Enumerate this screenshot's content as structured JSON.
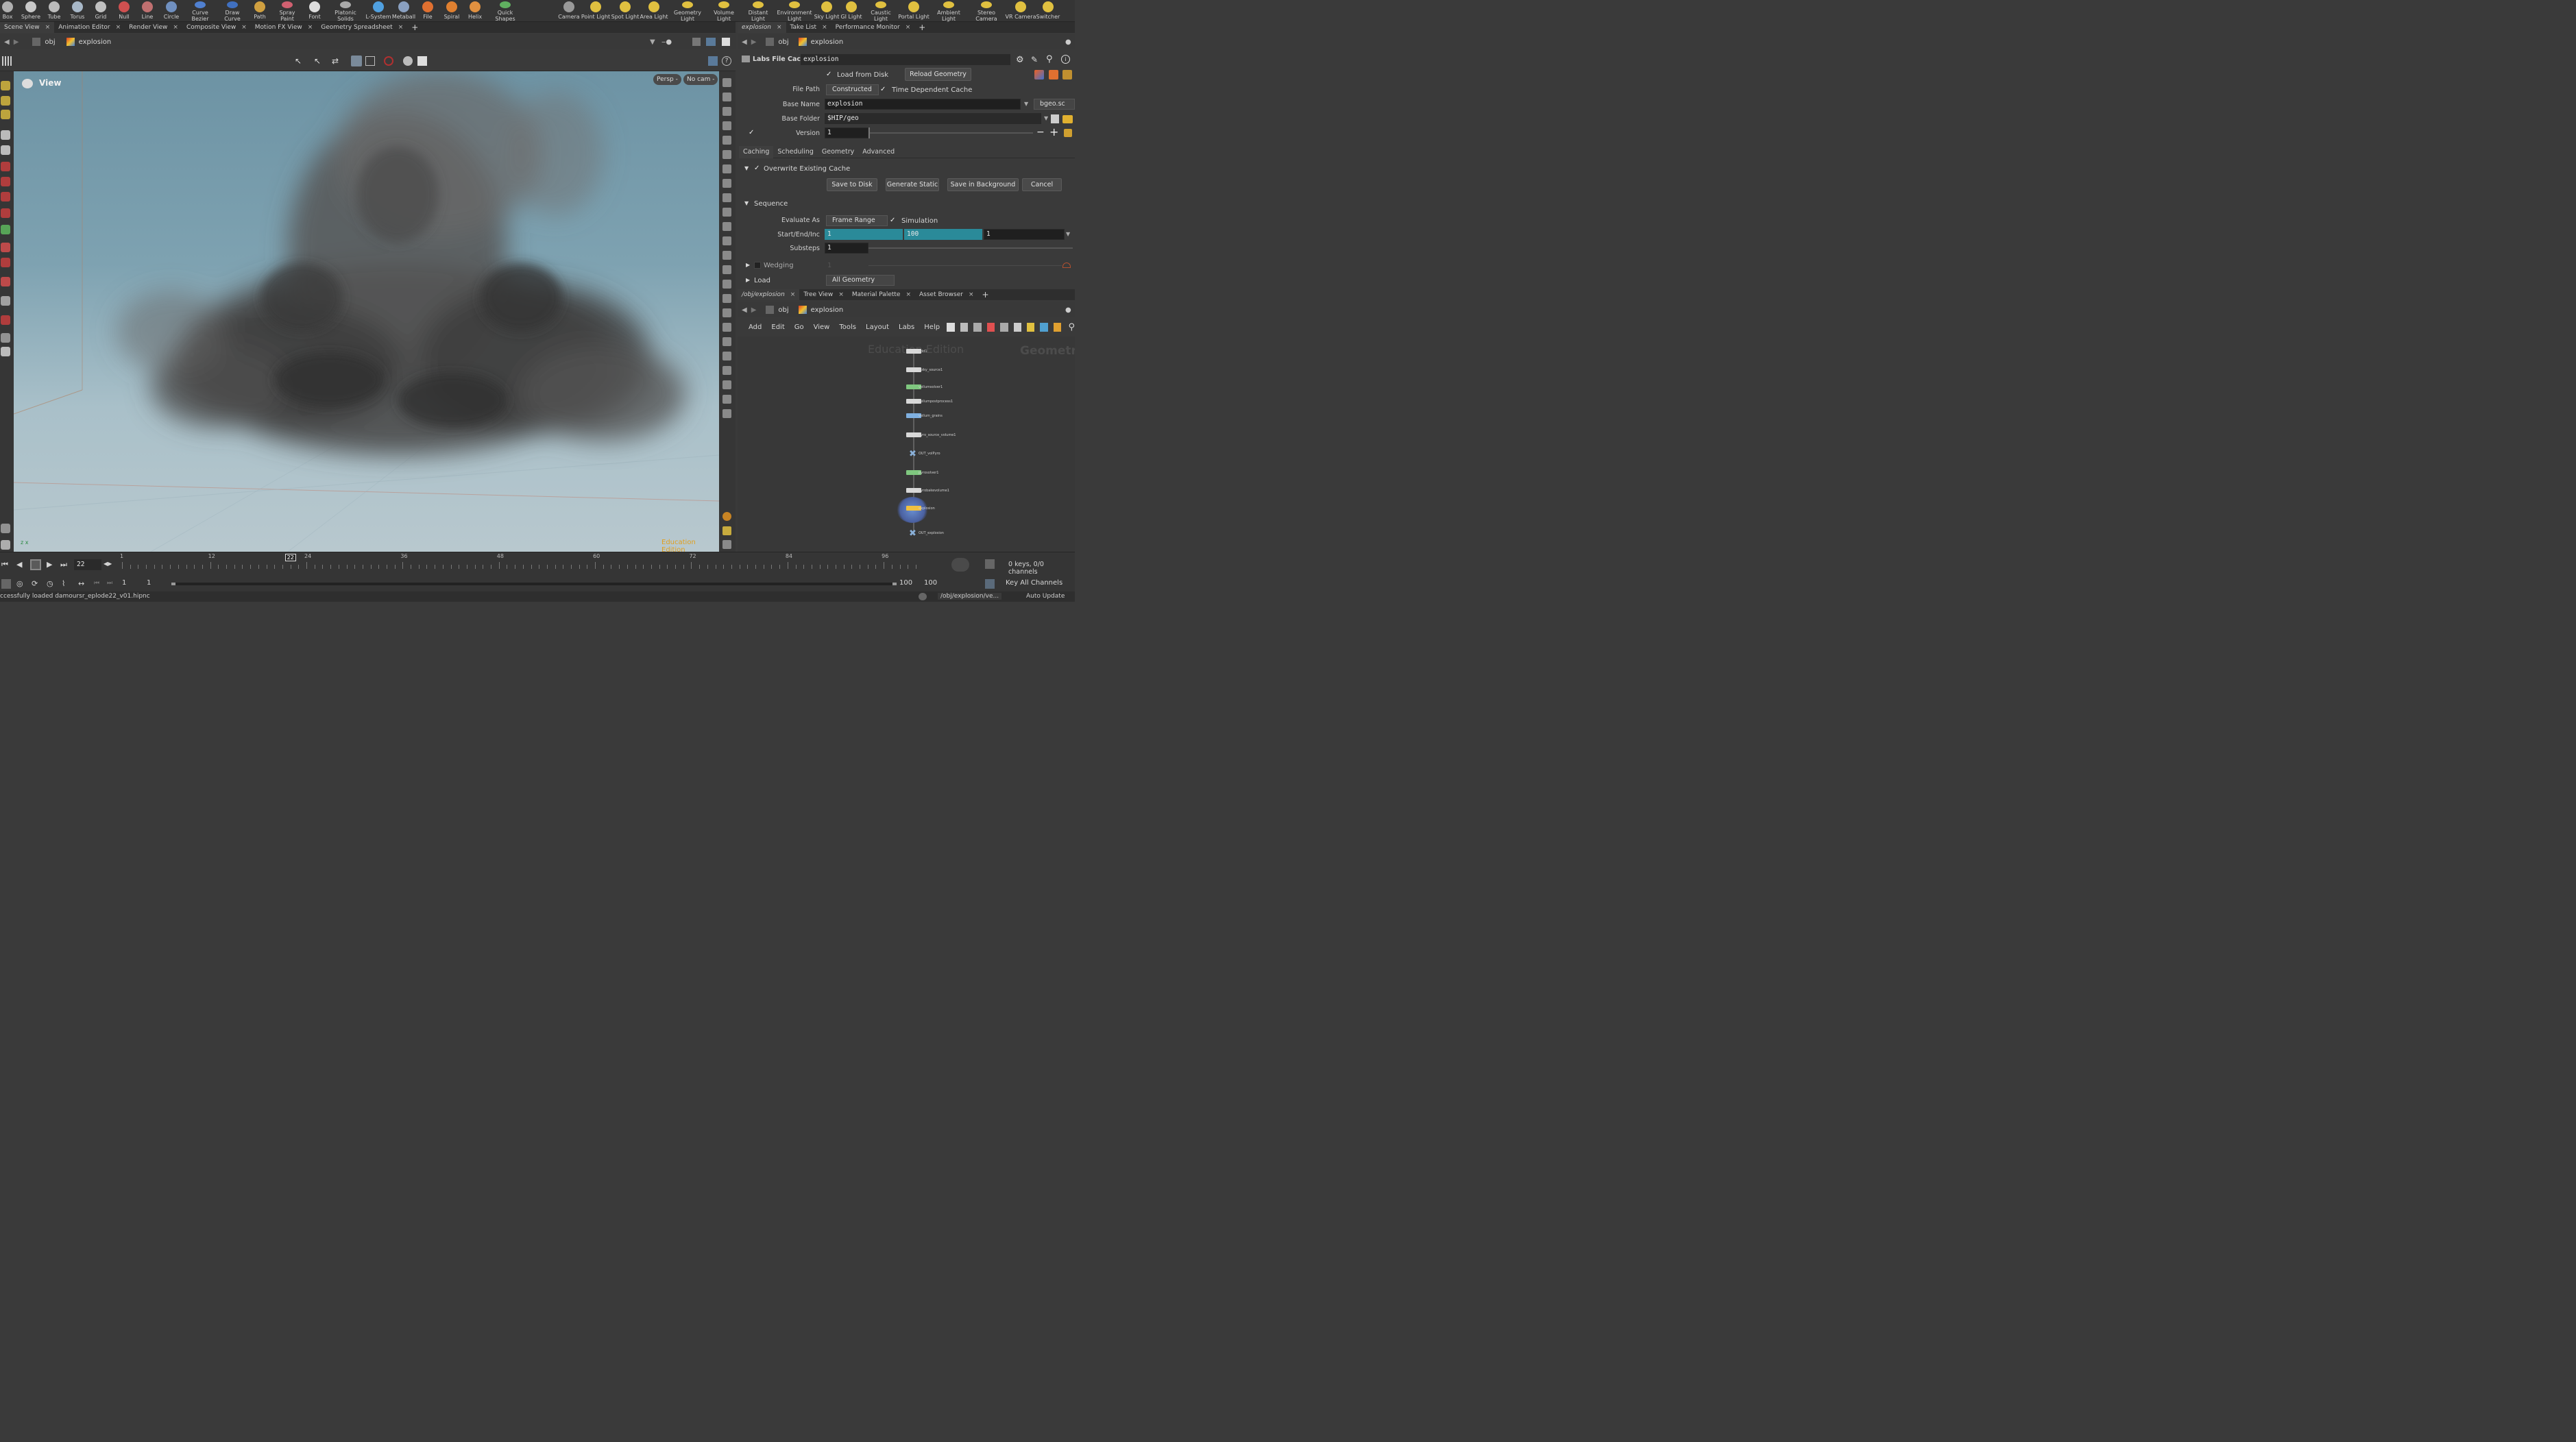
{
  "shelf": {
    "left_tools": [
      {
        "label": "Box",
        "icon": "box-icon"
      },
      {
        "label": "Sphere",
        "icon": "sphere-icon"
      },
      {
        "label": "Tube",
        "icon": "tube-icon"
      },
      {
        "label": "Torus",
        "icon": "torus-icon"
      },
      {
        "label": "Grid",
        "icon": "grid-icon"
      },
      {
        "label": "Null",
        "icon": "null-icon"
      },
      {
        "label": "Line",
        "icon": "line-icon"
      },
      {
        "label": "Circle",
        "icon": "circle-icon"
      },
      {
        "label": "Curve Bezier",
        "icon": "curve-bezier-icon"
      },
      {
        "label": "Draw Curve",
        "icon": "draw-curve-icon"
      },
      {
        "label": "Path",
        "icon": "path-icon"
      },
      {
        "label": "Spray Paint",
        "icon": "spray-paint-icon"
      },
      {
        "label": "Font",
        "icon": "font-icon"
      },
      {
        "label": "Platonic Solids",
        "icon": "platonic-solids-icon"
      },
      {
        "label": "L-System",
        "icon": "l-system-icon"
      },
      {
        "label": "Metaball",
        "icon": "metaball-icon"
      },
      {
        "label": "File",
        "icon": "file-icon"
      },
      {
        "label": "Spiral",
        "icon": "spiral-icon"
      },
      {
        "label": "Helix",
        "icon": "helix-icon"
      },
      {
        "label": "Quick Shapes",
        "icon": "quick-shapes-icon"
      }
    ],
    "right_tools": [
      {
        "label": "Camera",
        "icon": "camera-icon"
      },
      {
        "label": "Point Light",
        "icon": "point-light-icon"
      },
      {
        "label": "Spot Light",
        "icon": "spot-light-icon"
      },
      {
        "label": "Area Light",
        "icon": "area-light-icon"
      },
      {
        "label": "Geometry Light",
        "icon": "geometry-light-icon"
      },
      {
        "label": "Volume Light",
        "icon": "volume-light-icon"
      },
      {
        "label": "Distant Light",
        "icon": "distant-light-icon"
      },
      {
        "label": "Environment Light",
        "icon": "environment-light-icon"
      },
      {
        "label": "Sky Light",
        "icon": "sky-light-icon"
      },
      {
        "label": "GI Light",
        "icon": "gi-light-icon"
      },
      {
        "label": "Caustic Light",
        "icon": "caustic-light-icon"
      },
      {
        "label": "Portal Light",
        "icon": "portal-light-icon"
      },
      {
        "label": "Ambient Light",
        "icon": "ambient-light-icon"
      },
      {
        "label": "Stereo Camera",
        "icon": "stereo-camera-icon"
      },
      {
        "label": "VR Camera",
        "icon": "vr-camera-icon"
      },
      {
        "label": "Switcher",
        "icon": "switcher-icon"
      }
    ]
  },
  "left_tabs": [
    "Scene View",
    "Animation Editor",
    "Render View",
    "Composite View",
    "Motion FX View",
    "Geometry Spreadsheet"
  ],
  "left_path": {
    "root": "obj",
    "node": "explosion"
  },
  "viewport": {
    "title": "View",
    "persp": "Persp -",
    "cam": "No cam -",
    "watermark": "Education Edition",
    "axes_label": "z x"
  },
  "right_tabs": [
    "explosion",
    "Take List",
    "Performance Monitor"
  ],
  "right_path": {
    "root": "obj",
    "node": "explosion"
  },
  "params": {
    "node_type": "Labs File Cache",
    "node_name": "explosion",
    "load_from_disk": "Load from Disk",
    "reload_geometry": "Reload Geometry",
    "file_path_label": "File Path",
    "file_path_value": "Constructed",
    "time_dependent": "Time Dependent Cache",
    "base_name_label": "Base Name",
    "base_name_value": "explosion",
    "ext_value": "bgeo.sc",
    "base_folder_label": "Base Folder",
    "base_folder_value": "$HIP/geo",
    "version_label": "Version",
    "version_value": "1",
    "tabs": [
      "Caching",
      "Scheduling",
      "Geometry",
      "Advanced"
    ],
    "overwrite": "Overwrite Existing Cache",
    "save_to_disk": "Save to Disk",
    "generate_static": "Generate Static",
    "save_background": "Save in Background",
    "cancel": "Cancel",
    "sequence": "Sequence",
    "evaluate_label": "Evaluate As",
    "evaluate_value": "Frame Range",
    "simulation": "Simulation",
    "start_end_label": "Start/End/Inc",
    "start": "1",
    "end": "100",
    "inc": "1",
    "substeps_label": "Substeps",
    "substeps_value": "1",
    "wedging": "Wedging",
    "wedging_value": "1",
    "load_label": "Load",
    "load_value": "All Geometry"
  },
  "network_tabs": [
    "/obj/explosion",
    "Tree View",
    "Material Palette",
    "Asset Browser"
  ],
  "network_path": {
    "root": "obj",
    "node": "explosion"
  },
  "network_menu": [
    "Add",
    "Edit",
    "Go",
    "View",
    "Tools",
    "Layout",
    "Labs",
    "Help"
  ],
  "network_watermarks": {
    "edu": "Education Edition",
    "ctx": "Geometr"
  },
  "nodes": [
    {
      "name": "add1",
      "color": "#d8d8d8"
    },
    {
      "name": "spiky_source1",
      "color": "#d8d8d8"
    },
    {
      "name": "vellumsolver1",
      "color": "#7fc77f"
    },
    {
      "name": "vellumpostprocess1",
      "color": "#d8d8d8"
    },
    {
      "name": "vellum_grains",
      "color": "#7fb0e0"
    },
    {
      "name": "pyro_source_volume1",
      "color": "#d8d8d8"
    },
    {
      "name": "OUT_volPyro",
      "color": "#8ab0d8"
    },
    {
      "name": "pyrosolver1",
      "color": "#7fc77f"
    },
    {
      "name": "pyrobakevolume1",
      "color": "#d8d8d8"
    },
    {
      "name": "explosion",
      "color": "#f0c040"
    },
    {
      "name": "OUT_explosion",
      "color": "#8ab0d8"
    }
  ],
  "timeline": {
    "current_frame": "22",
    "ticks": [
      "1",
      "12",
      "24",
      "36",
      "48",
      "60",
      "72",
      "84",
      "96"
    ],
    "marker": "22",
    "range_start": "1",
    "range_start2": "1",
    "range_end": "100",
    "range_end2": "100",
    "keys_info": "0 keys, 0/0 channels",
    "key_all": "Key All Channels"
  },
  "status": {
    "message": "ccessfully loaded damoursr_eplode22_v01.hipnc",
    "path": "/obj/explosion/ve...",
    "update": "Auto Update"
  },
  "colors": {
    "accent": "#2a8a99",
    "edu_orange": "#e0a020"
  }
}
